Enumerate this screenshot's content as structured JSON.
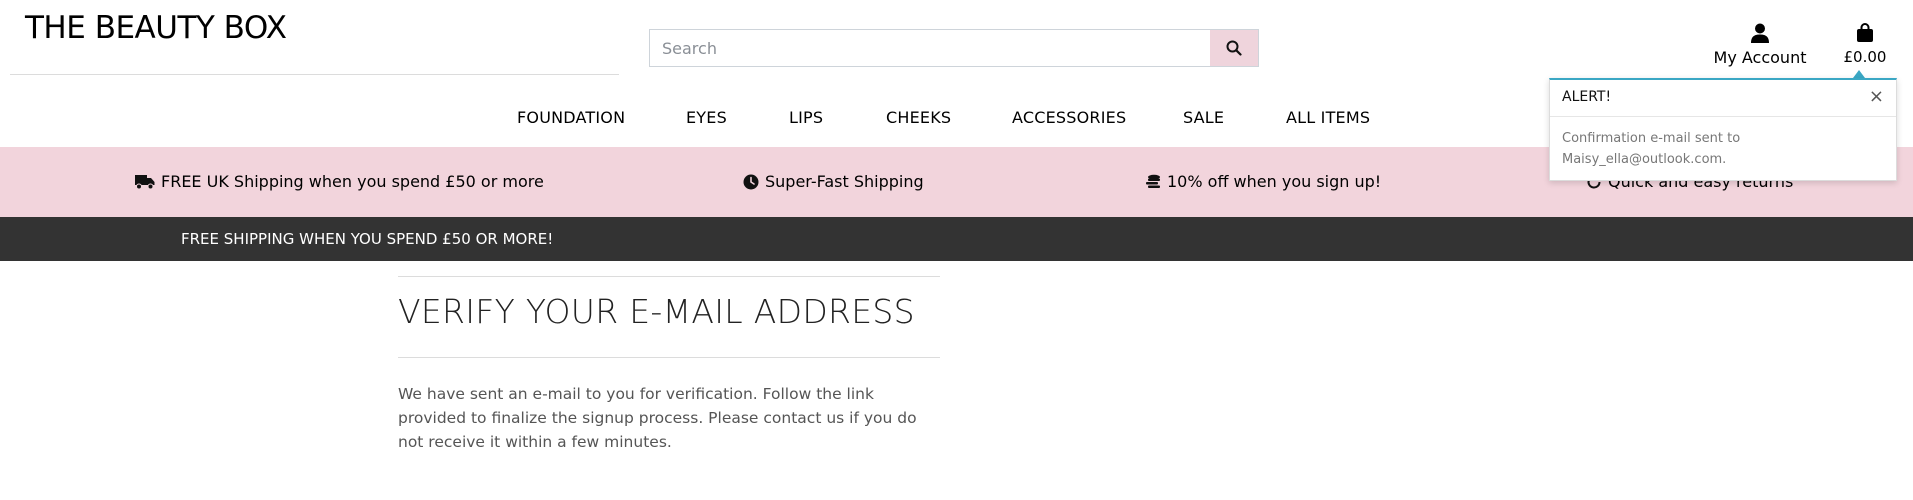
{
  "header": {
    "logo": "THE BEAUTY BOX",
    "search_placeholder": "Search",
    "account_label": "My Account",
    "bag_total": "£0.00"
  },
  "nav": {
    "items": [
      "FOUNDATION",
      "EYES",
      "LIPS",
      "CHEEKS",
      "ACCESSORIES",
      "SALE",
      "ALL ITEMS"
    ]
  },
  "benefits": [
    {
      "icon": "truck-icon",
      "text": "FREE UK Shipping when you spend £50 or more"
    },
    {
      "icon": "clock-icon",
      "text": "Super-Fast Shipping"
    },
    {
      "icon": "coins-icon",
      "text": "10% off when you sign up!"
    },
    {
      "icon": "return-icon",
      "text": "Quick and easy returns"
    }
  ],
  "banner": {
    "text": "FREE SHIPPING WHEN YOU SPEND £50 OR MORE!"
  },
  "main": {
    "title": "VERIFY YOUR E-MAIL ADDRESS",
    "body": "We have sent an e-mail to you for verification. Follow the link provided to finalize the signup process. Please contact us if you do not receive it within a few minutes."
  },
  "toast": {
    "title": "ALERT!",
    "close_symbol": "×",
    "message": "Confirmation e-mail sent to Maisy_ella@outlook.com."
  },
  "colors": {
    "benefits_bg": "#f2d4dc",
    "search_button_bg": "#efd4dc",
    "banner_bg": "#333333",
    "toast_accent": "#3aa7c4"
  }
}
